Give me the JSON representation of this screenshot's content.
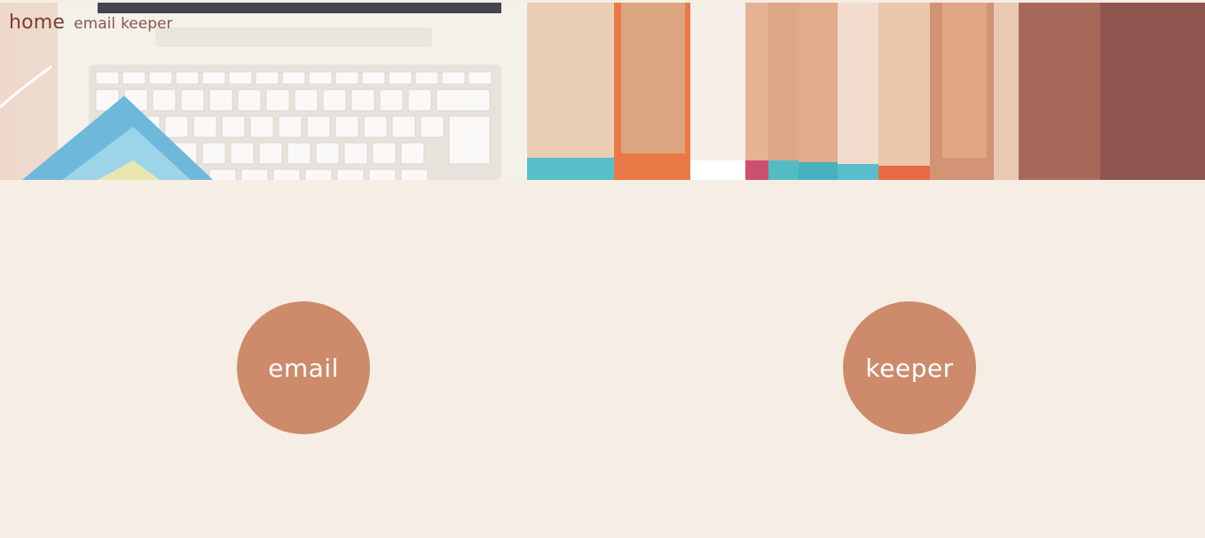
{
  "nav": {
    "home_label": "home",
    "links": [
      "email",
      "keeper"
    ]
  },
  "hero": {
    "image": "laptop-and-books-photo"
  },
  "circles": {
    "email_label": "email",
    "keeper_label": "keeper"
  },
  "colors": {
    "background": "#f6ede4",
    "circle": "#cd8b6b",
    "nav_home": "#7a3f33",
    "nav_link": "#8b5648"
  }
}
